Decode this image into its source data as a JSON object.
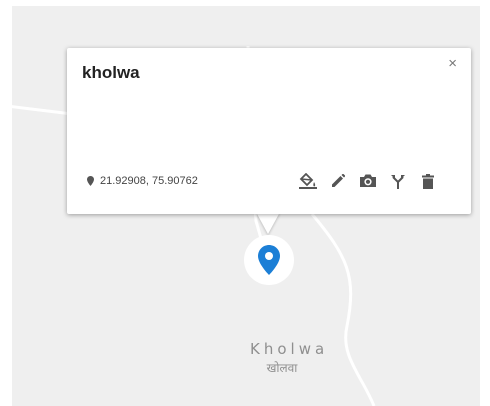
{
  "colors": {
    "map_background": "#efefef",
    "road": "#ffffff",
    "pin": "#1c7fd6",
    "icon": "#555555"
  },
  "map": {
    "place_label": "Kholwa",
    "place_label_local": "खोलवा"
  },
  "popup": {
    "title": "kholwa",
    "close_glyph": "×",
    "coordinates": "21.92908, 75.90762",
    "actions": [
      {
        "icon": "style-paint-bucket-icon"
      },
      {
        "icon": "edit-pencil-icon"
      },
      {
        "icon": "add-photo-camera-icon"
      },
      {
        "icon": "directions-icon"
      },
      {
        "icon": "delete-trash-icon"
      }
    ]
  },
  "marker": {
    "icon": "map-pin-icon"
  }
}
